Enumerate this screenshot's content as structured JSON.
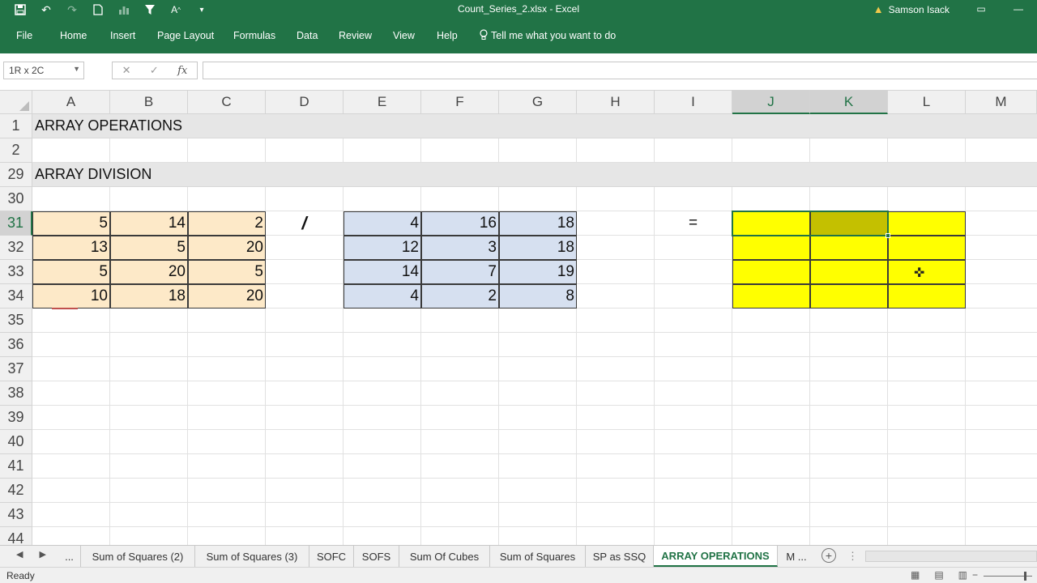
{
  "window": {
    "title": "Count_Series_2.xlsx  -  Excel",
    "user": "Samson Isack"
  },
  "qat": [
    "save-icon",
    "undo-icon",
    "redo-icon",
    "new-doc-icon",
    "chart-icon",
    "filter-icon",
    "font-size-icon",
    "customize-icon"
  ],
  "ribbon": {
    "tabs": [
      "File",
      "Home",
      "Insert",
      "Page Layout",
      "Formulas",
      "Data",
      "Review",
      "View",
      "Help"
    ],
    "tell_me": "Tell me what you want to do"
  },
  "formula_bar": {
    "name_box": "1R x 2C",
    "fx_label": "fx",
    "formula": ""
  },
  "columns": [
    "A",
    "B",
    "C",
    "D",
    "E",
    "F",
    "G",
    "H",
    "I",
    "J",
    "K",
    "L",
    "M"
  ],
  "rows": [
    "1",
    "2",
    "29",
    "30",
    "31",
    "32",
    "33",
    "34",
    "35",
    "36",
    "37",
    "38",
    "39",
    "40",
    "41",
    "42",
    "43",
    "44"
  ],
  "sheet": {
    "heading_1": "ARRAY OPERATIONS",
    "heading_2": "ARRAY DIVISION",
    "operator": "/",
    "equals": "=",
    "matrix_a": [
      [
        "5",
        "14",
        "2"
      ],
      [
        "13",
        "5",
        "20"
      ],
      [
        "5",
        "20",
        "5"
      ],
      [
        "10",
        "18",
        "20"
      ]
    ],
    "matrix_b": [
      [
        "4",
        "16",
        "18"
      ],
      [
        "12",
        "3",
        "18"
      ],
      [
        "14",
        "7",
        "19"
      ],
      [
        "4",
        "2",
        "8"
      ]
    ]
  },
  "sheet_tabs": [
    "...",
    "Sum of Squares (2)",
    "Sum of Squares (3)",
    "SOFC",
    "SOFS",
    "Sum Of Cubes",
    "Sum of Squares",
    "SP as SSQ",
    "ARRAY OPERATIONS",
    "M ..."
  ],
  "active_sheet": "ARRAY OPERATIONS",
  "status": {
    "text": "Ready"
  },
  "colors": {
    "excel_green": "#217346",
    "peach": "#fde9c8",
    "blue": "#d6e0f0",
    "yellow": "#ffff00"
  }
}
